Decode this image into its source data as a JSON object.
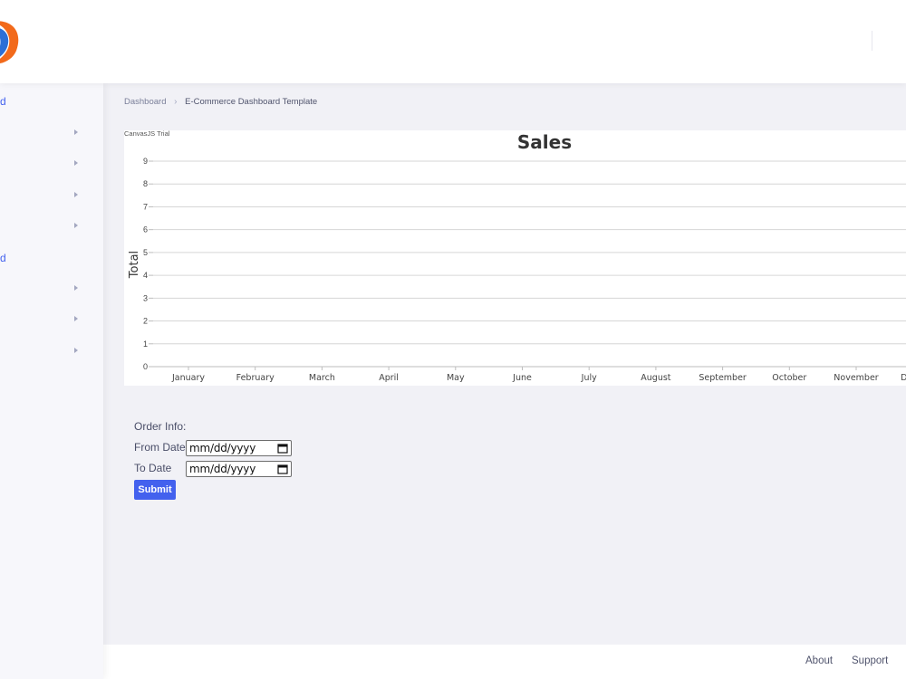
{
  "header": {
    "logo_icon": "brand-logo-icon"
  },
  "sidebar": {
    "fragments": [
      "d",
      "d"
    ],
    "arrow_icon": "caret-right-icon"
  },
  "breadcrumb": {
    "items": [
      "Dashboard",
      "E-Commerce Dashboard Template"
    ],
    "separator": "›"
  },
  "chart_widget": {
    "trial_label": "CanvasJS Trial"
  },
  "chart_data": {
    "type": "line",
    "title": "Sales",
    "xlabel": "",
    "ylabel": "Total",
    "categories": [
      "January",
      "February",
      "March",
      "April",
      "May",
      "June",
      "July",
      "August",
      "September",
      "October",
      "November",
      "December"
    ],
    "series": [],
    "ylim": [
      0,
      9
    ],
    "yticks": [
      0,
      1,
      2,
      3,
      4,
      5,
      6,
      7,
      8,
      9
    ],
    "grid": true
  },
  "order_form": {
    "title": "Order Info:",
    "from_label": "From Date",
    "to_label": "To Date",
    "date_placeholder": "mm/dd/yyyy",
    "submit_label": "Submit",
    "calendar_icon": "calendar-icon"
  },
  "footer": {
    "links": [
      "About",
      "Support"
    ]
  },
  "colors": {
    "accent": "#4361ee",
    "page_bg": "#f1f1f6",
    "grid": "#d6d6d6",
    "chart_title": "#333333"
  }
}
